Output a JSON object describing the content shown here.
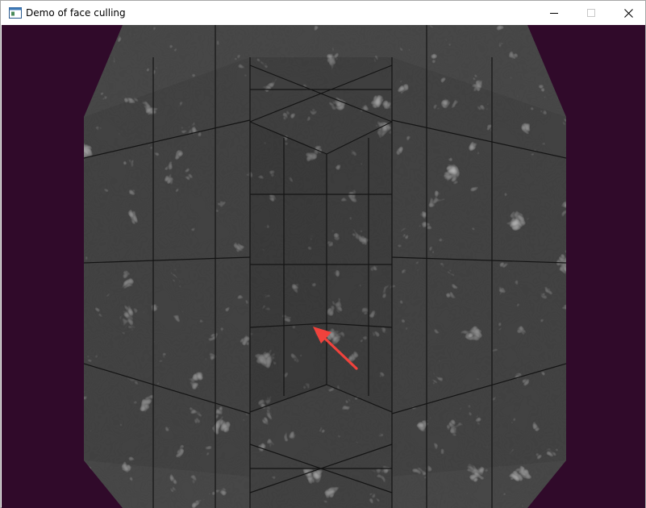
{
  "window": {
    "title": "Demo of face culling",
    "controls": {
      "minimize_icon": "minimize-icon",
      "maximize_icon": "maximize-icon",
      "close_icon": "close-icon"
    }
  },
  "scene": {
    "description_icon": "textured-cube-interior",
    "background_color": "#300a2a",
    "texture_base_color": "#454545",
    "edge_color": "#121212",
    "arrow_color": "#f0423c"
  }
}
